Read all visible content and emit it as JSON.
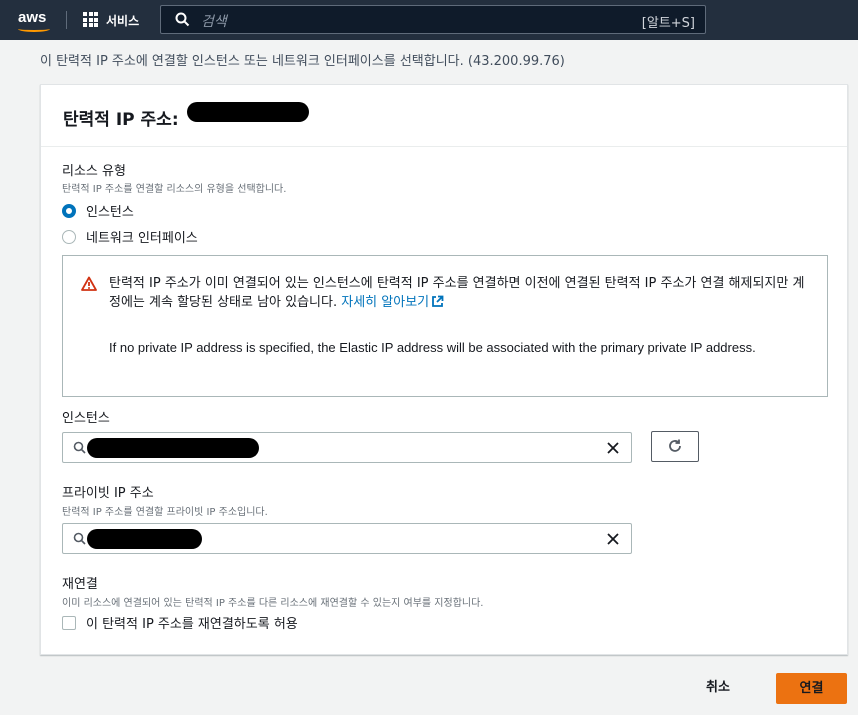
{
  "nav": {
    "logo": "aws",
    "services_label": "서비스",
    "search_placeholder": "검색",
    "search_shortcut": "[알트+S]"
  },
  "page": {
    "description": "이 탄력적 IP 주소에 연결할 인스턴스 또는 네트워크 인터페이스를 선택합니다. (43.200.99.76)"
  },
  "panel": {
    "title": "탄력적 IP 주소:",
    "resource_type": {
      "label": "리소스 유형",
      "description": "탄력적 IP 주소를 연결할 리소스의 유형을 선택합니다.",
      "options": [
        {
          "label": "인스턴스",
          "selected": true
        },
        {
          "label": "네트워크 인터페이스",
          "selected": false
        }
      ]
    },
    "alert": {
      "text": "탄력적 IP 주소가 이미 연결되어 있는 인스턴스에 탄력적 IP 주소를 연결하면 이전에 연결된 탄력적 IP 주소가 연결 해제되지만 계정에는 계속 할당된 상태로 남아 있습니다.",
      "link": "자세히 알아보기",
      "english": "If no private IP address is specified, the Elastic IP address will be associated with the primary private IP address."
    },
    "instance": {
      "label": "인스턴스"
    },
    "private_ip": {
      "label": "프라이빗 IP 주소",
      "description": "탄력적 IP 주소를 연결할 프라이빗 IP 주소입니다."
    },
    "reassociation": {
      "label": "재연결",
      "description": "이미 리소스에 연결되어 있는 탄력적 IP 주소를 다른 리소스에 재연결할 수 있는지 여부를 지정합니다.",
      "checkbox_label": "이 탄력적 IP 주소를 재연결하도록 허용",
      "checked": false
    }
  },
  "footer": {
    "cancel_label": "취소",
    "connect_label": "연결"
  },
  "colors": {
    "nav_bg": "#232f3e",
    "primary_button": "#ec7211",
    "link": "#0073bb",
    "warning": "#d13212"
  }
}
